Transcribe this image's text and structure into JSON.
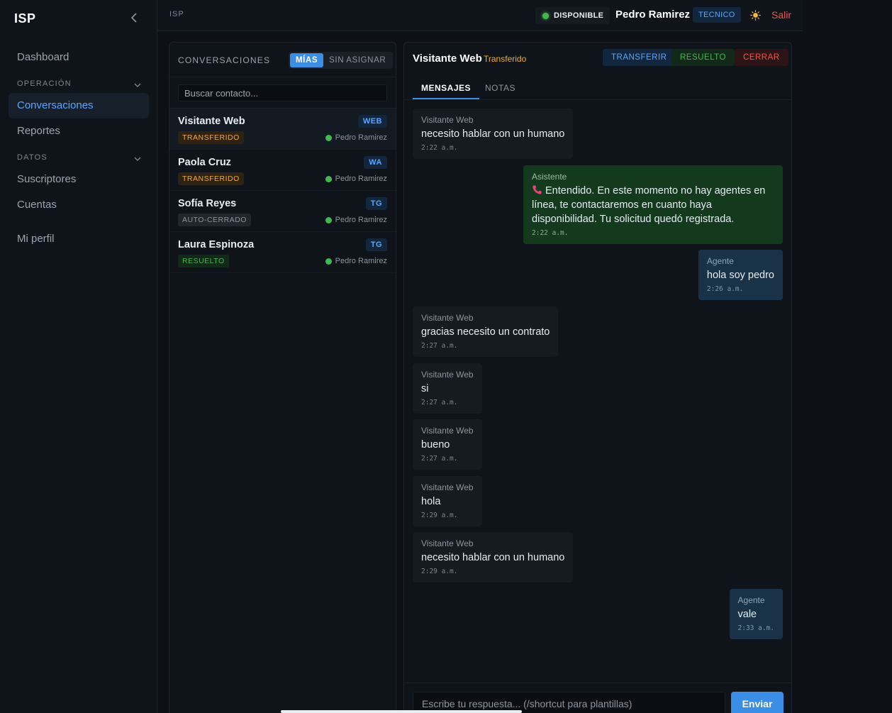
{
  "sidebar": {
    "brand": "ISP",
    "items": {
      "dashboard": "Dashboard",
      "conversaciones": "Conversaciones",
      "reportes": "Reportes",
      "suscriptores": "Suscriptores",
      "cuentas": "Cuentas",
      "perfil": "Mi perfil"
    },
    "sections": {
      "operacion": "OPERACIÓN",
      "datos": "DATOS"
    }
  },
  "topbar": {
    "breadcrumb": "ISP",
    "status": "DISPONIBLE",
    "user_name": "Pedro Ramirez",
    "role": "TECNICO",
    "logout": "Salir"
  },
  "conversations": {
    "title": "CONVERSACIONES",
    "filter_mine": "MÍAS",
    "filter_unassigned": "SIN ASIGNAR",
    "search_placeholder": "Buscar contacto...",
    "items": [
      {
        "name": "Visitante Web",
        "channel": "WEB",
        "state": "TRANSFERIDO",
        "assignee": "Pedro Ramirez"
      },
      {
        "name": "Paola Cruz",
        "channel": "WA",
        "state": "TRANSFERIDO",
        "assignee": "Pedro Ramirez"
      },
      {
        "name": "Sofía Reyes",
        "channel": "TG",
        "state": "AUTO-CERRADO",
        "assignee": "Pedro Ramirez"
      },
      {
        "name": "Laura Espinoza",
        "channel": "TG",
        "state": "RESUELTO",
        "assignee": "Pedro Ramirez"
      }
    ]
  },
  "chat": {
    "title": "Visitante Web",
    "status": "Transferido",
    "actions": {
      "transfer": "TRANSFERIR",
      "resolve": "RESUELTO",
      "close": "CERRAR"
    },
    "tabs": {
      "messages": "MENSAJES",
      "notes": "NOTAS"
    },
    "messages": [
      {
        "sender": "Visitante Web",
        "text": "necesito hablar con un humano",
        "time": "2:22 a.m."
      },
      {
        "sender": "Asistente",
        "text": "Entendido. En este momento no hay agentes en línea, te contactaremos en cuanto haya disponibilidad. Tu solicitud quedó registrada.",
        "time": "2:22 a.m."
      },
      {
        "sender": "Agente",
        "text": "hola soy pedro",
        "time": "2:26 a.m."
      },
      {
        "sender": "Visitante Web",
        "text": "gracias necesito un contrato",
        "time": "2:27 a.m."
      },
      {
        "sender": "Visitante Web",
        "text": "si",
        "time": "2:27 a.m."
      },
      {
        "sender": "Visitante Web",
        "text": "bueno",
        "time": "2:27 a.m."
      },
      {
        "sender": "Visitante Web",
        "text": "hola",
        "time": "2:29 a.m."
      },
      {
        "sender": "Visitante Web",
        "text": "necesito hablar con un humano",
        "time": "2:29 a.m."
      },
      {
        "sender": "Agente",
        "text": "vale",
        "time": "2:33 a.m."
      }
    ],
    "reply_placeholder": "Escribe tu respuesta... (/shortcut para plantillas)",
    "send_label": "Enviar"
  },
  "colors": {
    "accent": "#3a8ee6",
    "online": "#3fb950",
    "warning": "#f0a93b",
    "danger": "#f85149"
  }
}
